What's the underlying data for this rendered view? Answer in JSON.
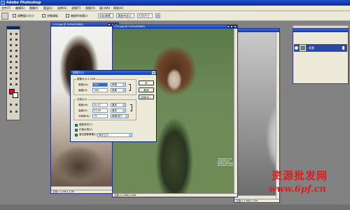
{
  "app": {
    "title": "Adobe Photoshop"
  },
  "menu": [
    "文件(F)",
    "编辑(E)",
    "图像(I)",
    "图层(L)",
    "选择(S)",
    "滤镜(T)",
    "视图(V)",
    "窗口(W)",
    "帮助(H)"
  ],
  "options": {
    "resize_windows": "调整窗口大小",
    "ignore_palettes": "忽略调板",
    "zoom_all_windows": "缩放所有窗口",
    "actual_pixels": "实际像素",
    "fit_on_screen": "满画布显示",
    "print_size": "打印尺寸"
  },
  "doc_left": {
    "title": "1-01.jpg @ 100%(RGB/8)",
    "status": "文档:1.12M/1.12M"
  },
  "doc_main": {
    "title": "1-01.jpg @ 100%(RGB/8)",
    "status": "文档:1.12M/1.12M",
    "caption": "FASHION STYLE HAIR BEAUTY MODEL PORTRAIT EDITORIAL LOOK"
  },
  "doc_right": {
    "status": "文档:1.12M/1.12M"
  },
  "layers": {
    "layer_name": "背景"
  },
  "dialog": {
    "title": "图像大小",
    "pixel_dims_label": "像素大小:1.12M",
    "width_label": "宽度(W):",
    "height_label": "高度(H):",
    "px_width": "500",
    "px_height": "768",
    "px_unit_w": "像素",
    "px_unit_h": "像素",
    "doc_size_label": "文档大小:",
    "doc_width": "20.07",
    "doc_height": "27.09",
    "resolution_label": "分辨率(R):",
    "resolution": "72",
    "cm_w": "厘米",
    "cm_h": "厘米",
    "res_unit": "像素/英寸",
    "ok": "好",
    "cancel": "取消",
    "auto": "自动(A)...",
    "scale_styles": "缩放样式(Y)",
    "constrain": "约束比例(C)",
    "resample": "重定图像像素(I):",
    "resample_method": "两次立方"
  },
  "watermark": {
    "line1": "资源批发网",
    "line2": "www.6pf.cn"
  },
  "colors": {
    "foreground": "#e2081e",
    "background": "#ffffff",
    "titlebar": "#0a3aa3"
  }
}
